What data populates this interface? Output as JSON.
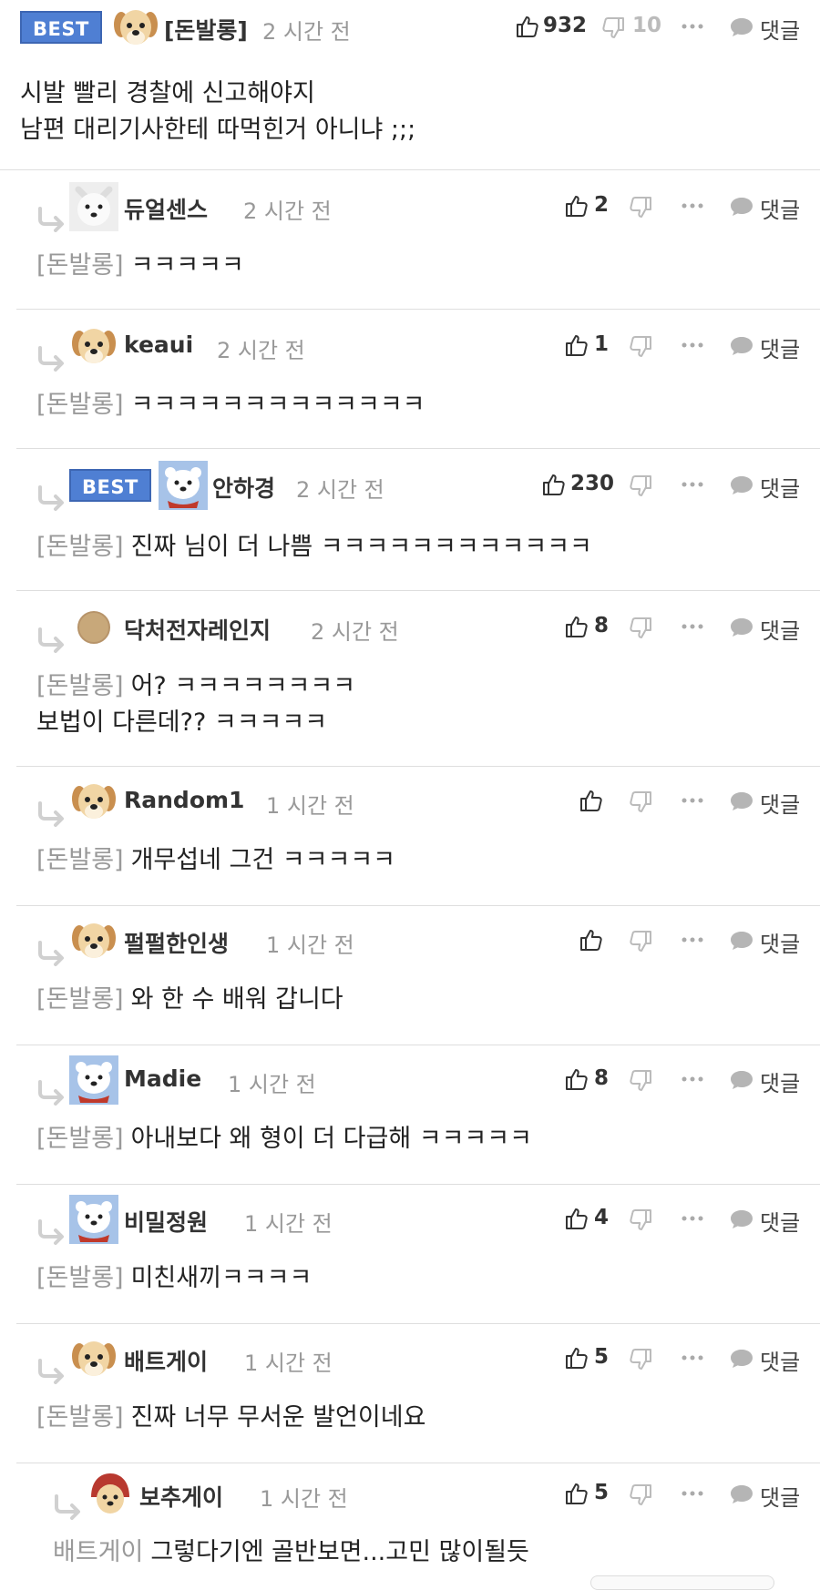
{
  "ui": {
    "reply_label": "댓글"
  },
  "comments": [
    {
      "author": "[돈발롱]",
      "time": "2 시간 전",
      "best_label": "BEST",
      "up": "932",
      "down": "10",
      "avatar": "puppy-avatar",
      "body_lines": [
        "시발 빨리 경찰에 신고해야지",
        "남편 대리기사한테 따먹힌거 아니냐 ;;;"
      ]
    },
    {
      "author": "듀얼센스",
      "time": "2 시간 전",
      "up": "2",
      "avatar": "white-dog-avatar",
      "mention": "[돈발롱]",
      "body_lines": [
        "ㅋㅋㅋㅋㅋ"
      ]
    },
    {
      "author": "keaui",
      "time": "2 시간 전",
      "up": "1",
      "avatar": "puppy-avatar",
      "mention": "[돈발롱]",
      "body_lines": [
        "ㅋㅋㅋㅋㅋㅋㅋㅋㅋㅋㅋㅋㅋ"
      ]
    },
    {
      "author": "안하경",
      "time": "2 시간 전",
      "up": "230",
      "best_label": "BEST",
      "avatar": "polar-bear-avatar",
      "mention": "[돈발롱]",
      "body_lines": [
        "진짜 님이 더 나쁨 ㅋㅋㅋㅋㅋㅋㅋㅋㅋㅋㅋㅋ"
      ]
    },
    {
      "author": "닥처전자레인지",
      "time": "2 시간 전",
      "up": "8",
      "avatar": "brown-circle-avatar",
      "mention": "[돈발롱]",
      "body_lines": [
        "어? ㅋㅋㅋㅋㅋㅋㅋㅋ",
        "보법이 다른데?? ㅋㅋㅋㅋㅋ"
      ]
    },
    {
      "author": "Random1",
      "time": "1 시간 전",
      "up": "",
      "avatar": "puppy-avatar",
      "mention": "[돈발롱]",
      "body_lines": [
        "개무섭네 그건 ㅋㅋㅋㅋㅋ"
      ]
    },
    {
      "author": "펄펄한인생",
      "time": "1 시간 전",
      "up": "",
      "avatar": "puppy-avatar",
      "mention": "[돈발롱]",
      "body_lines": [
        "와 한 수 배워 갑니다"
      ]
    },
    {
      "author": "Madie",
      "time": "1 시간 전",
      "up": "8",
      "avatar": "polar-bear-avatar",
      "mention": "[돈발롱]",
      "body_lines": [
        "아내보다 왜 형이 더 다급해 ㅋㅋㅋㅋㅋ"
      ]
    },
    {
      "author": "비밀정원",
      "time": "1 시간 전",
      "up": "4",
      "avatar": "polar-bear-avatar",
      "mention": "[돈발롱]",
      "body_lines": [
        "미친새끼ㅋㅋㅋㅋ"
      ]
    },
    {
      "author": "배트게이",
      "time": "1 시간 전",
      "up": "5",
      "avatar": "puppy-avatar",
      "mention": "[돈발롱]",
      "body_lines": [
        "진짜 너무 무서운 발언이네요"
      ]
    },
    {
      "author": "보추게이",
      "time": "1 시간 전",
      "up": "5",
      "avatar": "hooded-puppy-avatar",
      "mention": "배트게이",
      "body_lines": [
        "그렇다기엔 골반보면...고민 많이될듯"
      ]
    }
  ]
}
